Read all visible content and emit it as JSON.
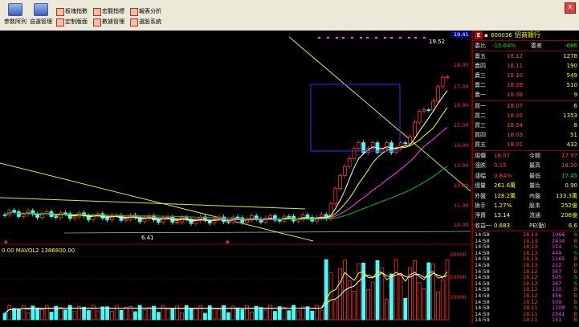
{
  "toolbar": {
    "buttons": [
      {
        "label": "参数阿列"
      },
      {
        "label": "自選管理"
      }
    ],
    "small_buttons": [
      {
        "label": "板塊指數"
      },
      {
        "label": "定制版面"
      },
      {
        "label": "宏觀指標"
      },
      {
        "label": "數據管理"
      },
      {
        "label": "報表分析"
      },
      {
        "label": "選股系統"
      }
    ],
    "close_label": "x"
  },
  "chart": {
    "price_high_label": "19.52",
    "price_low_label": "6.41",
    "volume_title": "0.00 MAVOL2 1386800.00",
    "price_axis": [
      "19.41",
      "18.00",
      "17.00",
      "16.00",
      "15.00",
      "14.00",
      "13.00",
      "12.00",
      "11.00",
      "10.00"
    ],
    "volume_axis": [
      "30000",
      "20000",
      "10000"
    ],
    "colors": {
      "up": "#ff3030",
      "down": "#40ffff",
      "ma1": "#ffffff",
      "ma2": "#ffff00",
      "ma3": "#ff40ff",
      "ma4": "#00c000",
      "trend": "#e0e040"
    }
  },
  "quote": {
    "code": "600036",
    "name": "招商銀行",
    "icon_label": "E",
    "weibi_label": "委比",
    "weibi_val": "-15.64%",
    "weicha_label": "委差",
    "weicha_val": "-686",
    "sells": [
      {
        "label": "賣五",
        "price": "18.12",
        "vol": "1278"
      },
      {
        "label": "賣四",
        "price": "18.11",
        "vol": "190"
      },
      {
        "label": "賣三",
        "price": "18.10",
        "vol": "549"
      },
      {
        "label": "賣二",
        "price": "18.09",
        "vol": "510"
      },
      {
        "label": "賣一",
        "price": "18.08",
        "vol": "9"
      }
    ],
    "buys": [
      {
        "label": "買一",
        "price": "18.07",
        "vol": "6"
      },
      {
        "label": "買二",
        "price": "18.05",
        "vol": "1353"
      },
      {
        "label": "買三",
        "price": "18.04",
        "vol": "8"
      },
      {
        "label": "買四",
        "price": "18.03",
        "vol": "51"
      },
      {
        "label": "買五",
        "price": "18.01",
        "vol": "432"
      }
    ],
    "stats": [
      {
        "l1": "現價",
        "v1": "18.07",
        "l2": "今開",
        "v2": "17.97"
      },
      {
        "l1": "漲跌",
        "v1": "0.15",
        "l2": "最高",
        "v2": "18.20"
      },
      {
        "l1": "漲幅",
        "v1": "0.84%",
        "l2": "最低",
        "v2": "17.45"
      },
      {
        "l1": "總量",
        "v1": "261.6萬",
        "l2": "量比",
        "v2": "0.90"
      },
      {
        "l1": "外盤",
        "v1": "128.2萬",
        "l2": "內盤",
        "v2": "133.3萬"
      },
      {
        "l1": "換手",
        "v1": "1.27%",
        "l2": "股本",
        "v2": "252億"
      },
      {
        "l1": "淨資",
        "v1": "13.14",
        "l2": "流通",
        "v2": "206億"
      },
      {
        "l1": "收益一",
        "v1": "0.683",
        "l2": "PE(動)",
        "v2": "6.6"
      }
    ],
    "ticks": [
      {
        "t": "14:58",
        "p": "18.13",
        "v": "1066",
        "s": "S"
      },
      {
        "t": "14:58",
        "p": "18.13",
        "v": "2434",
        "s": "B"
      },
      {
        "t": "14:58",
        "p": "18.13",
        "v": "314",
        "s": "S"
      },
      {
        "t": "14:58",
        "p": "18.13",
        "v": "449",
        "s": "S"
      },
      {
        "t": "14:58",
        "p": "18.13",
        "v": "1165",
        "s": "B"
      },
      {
        "t": "14:58",
        "p": "18.13",
        "v": "212",
        "s": "B"
      },
      {
        "t": "14:58",
        "p": "18.12",
        "v": "367",
        "s": "B"
      },
      {
        "t": "14:58",
        "p": "18.12",
        "v": "505",
        "s": "S"
      },
      {
        "t": "14:58",
        "p": "18.12",
        "v": "367",
        "s": "S"
      },
      {
        "t": "14:58",
        "p": "18.12",
        "v": "110",
        "s": "B"
      },
      {
        "t": "14:58",
        "p": "18.12",
        "v": "456",
        "s": "B"
      },
      {
        "t": "14:58",
        "p": "18.12",
        "v": "509",
        "s": "B"
      },
      {
        "t": "14:58",
        "p": "18.11",
        "v": "1108",
        "s": "S"
      },
      {
        "t": "14:59",
        "p": "18.11",
        "v": "2541",
        "s": "B"
      },
      {
        "t": "14:59",
        "p": "18.11",
        "v": "151",
        "s": "B"
      }
    ]
  }
}
